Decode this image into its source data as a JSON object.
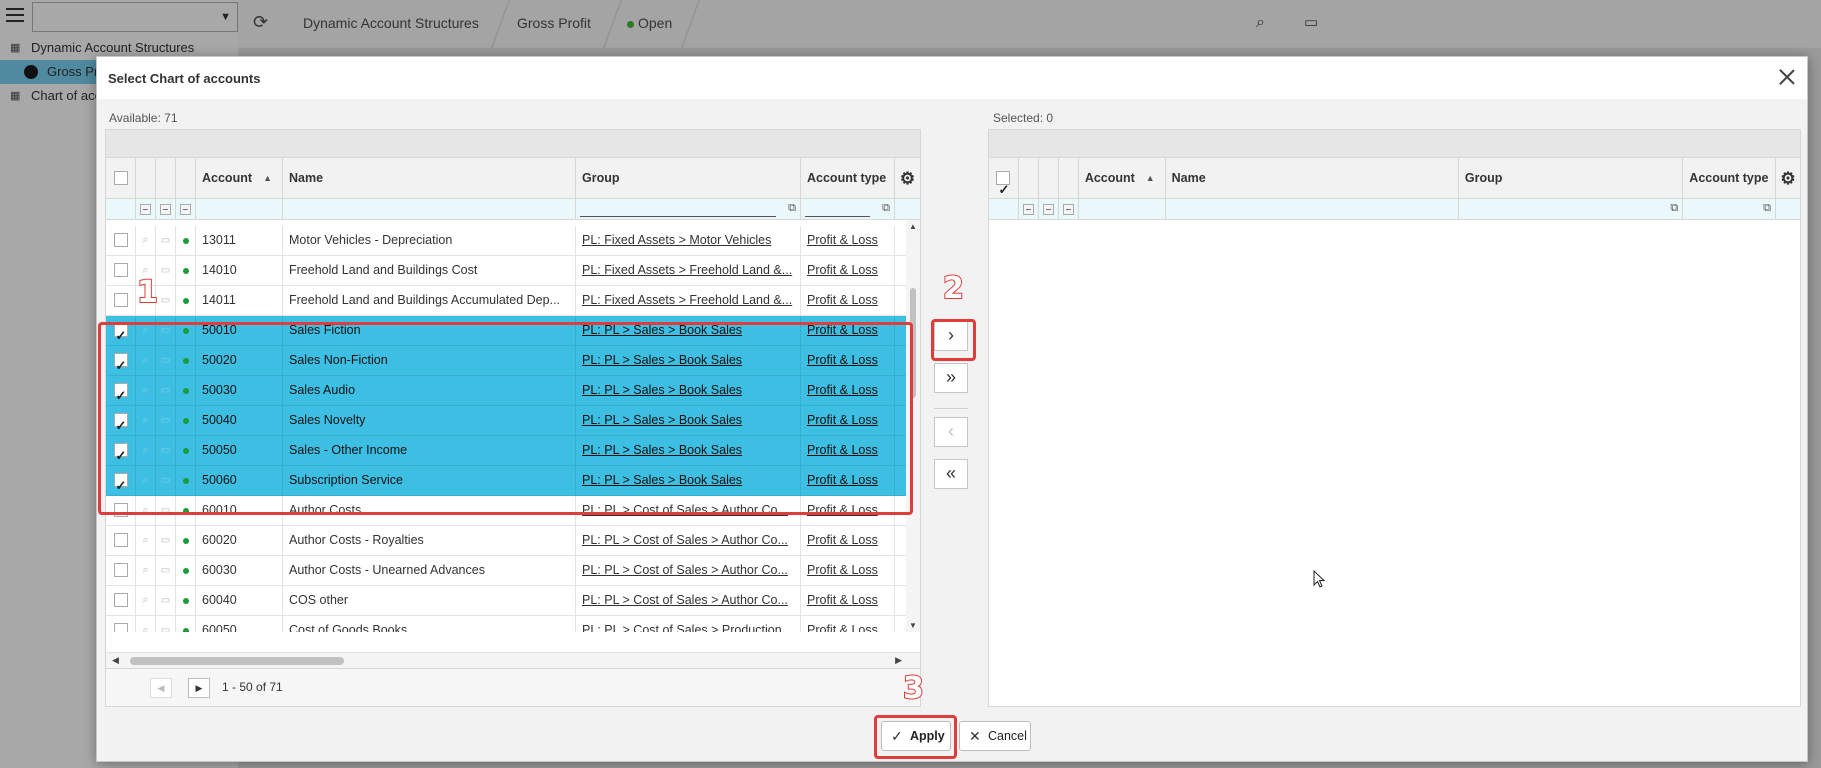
{
  "background": {
    "tree": [
      {
        "label": "Dynamic Account Structures",
        "icon": "grid-icon"
      },
      {
        "label": "Gross Profit",
        "icon": "compass-icon"
      },
      {
        "label": "Chart of accounts",
        "icon": "grid-icon"
      }
    ],
    "breadcrumb": [
      "Dynamic Account Structures",
      "Gross Profit",
      "Open"
    ]
  },
  "dialog": {
    "title": "Select Chart of accounts",
    "available_label": "Available: 71",
    "selected_label": "Selected: 0",
    "columns": {
      "account": "Account",
      "name": "Name",
      "group": "Group",
      "account_type": "Account type"
    },
    "available_rows": [
      {
        "account": "13011",
        "name": "Motor Vehicles - Depreciation",
        "group": "PL: Fixed Assets > Motor Vehicles",
        "type": "Profit & Loss",
        "checked": false
      },
      {
        "account": "14010",
        "name": "Freehold Land and Buildings Cost",
        "group": "PL: Fixed Assets > Freehold Land &...",
        "type": "Profit & Loss",
        "checked": false
      },
      {
        "account": "14011",
        "name": "Freehold Land and Buildings Accumulated Dep...",
        "group": "PL: Fixed Assets > Freehold Land &...",
        "type": "Profit & Loss",
        "checked": false
      },
      {
        "account": "50010",
        "name": "Sales Fiction",
        "group": "PL: PL > Sales > Book Sales",
        "type": "Profit & Loss",
        "checked": true
      },
      {
        "account": "50020",
        "name": "Sales Non-Fiction",
        "group": "PL: PL > Sales > Book Sales",
        "type": "Profit & Loss",
        "checked": true
      },
      {
        "account": "50030",
        "name": "Sales Audio",
        "group": "PL: PL > Sales > Book Sales",
        "type": "Profit & Loss",
        "checked": true
      },
      {
        "account": "50040",
        "name": "Sales Novelty",
        "group": "PL: PL > Sales > Book Sales",
        "type": "Profit & Loss",
        "checked": true
      },
      {
        "account": "50050",
        "name": "Sales - Other Income",
        "group": "PL: PL > Sales > Book Sales",
        "type": "Profit & Loss",
        "checked": true
      },
      {
        "account": "50060",
        "name": "Subscription Service",
        "group": "PL: PL > Sales > Book Sales",
        "type": "Profit & Loss",
        "checked": true
      },
      {
        "account": "60010",
        "name": "Author Costs",
        "group": "PL: PL > Cost of Sales > Author Co...",
        "type": "Profit & Loss",
        "checked": false
      },
      {
        "account": "60020",
        "name": "Author Costs - Royalties",
        "group": "PL: PL > Cost of Sales > Author Co...",
        "type": "Profit & Loss",
        "checked": false
      },
      {
        "account": "60030",
        "name": "Author Costs - Unearned Advances",
        "group": "PL: PL > Cost of Sales > Author Co...",
        "type": "Profit & Loss",
        "checked": false
      },
      {
        "account": "60040",
        "name": "COS other",
        "group": "PL: PL > Cost of Sales > Author Co...",
        "type": "Profit & Loss",
        "checked": false
      },
      {
        "account": "60050",
        "name": "Cost of Goods Books",
        "group": "PL: PL > Cost of Sales > Production...",
        "type": "Profit & Loss",
        "checked": false
      }
    ],
    "pager_info": "1 - 50 of 71",
    "apply_label": "Apply",
    "cancel_label": "Cancel",
    "annotations": [
      "1",
      "2",
      "3"
    ]
  },
  "colors": {
    "selected_row": "#3cbfe3",
    "annotation": "#e03c3c",
    "status_dot": "#1a9c3a"
  }
}
